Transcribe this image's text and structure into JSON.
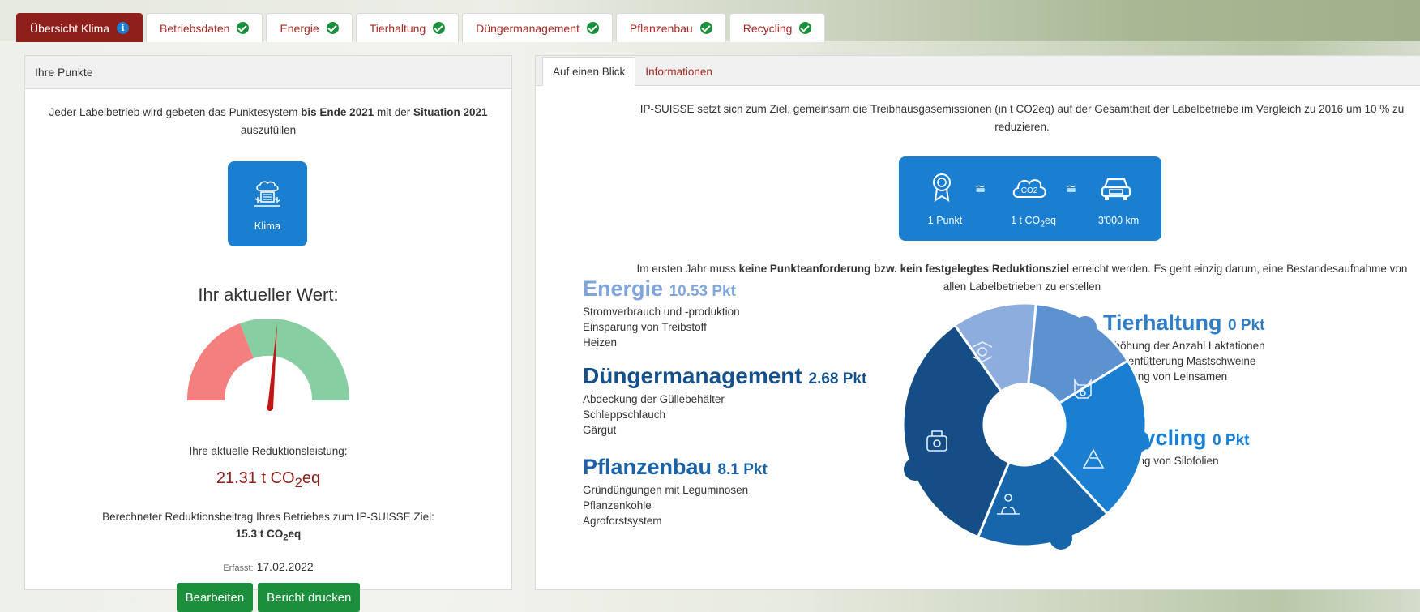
{
  "tabs": [
    {
      "label": "Übersicht Klima",
      "status": "info"
    },
    {
      "label": "Betriebsdaten",
      "status": "done"
    },
    {
      "label": "Energie",
      "status": "done"
    },
    {
      "label": "Tierhaltung",
      "status": "done"
    },
    {
      "label": "Düngermanagement",
      "status": "done"
    },
    {
      "label": "Pflanzenbau",
      "status": "done"
    },
    {
      "label": "Recycling",
      "status": "done"
    }
  ],
  "left": {
    "header": "Ihre Punkte",
    "intro_1": "Jeder Labelbetrieb wird gebeten das Punktesystem ",
    "intro_bold_1": "bis Ende 2021",
    "intro_2": " mit der ",
    "intro_bold_2": "Situation 2021",
    "intro_3": " auszufüllen",
    "klima_label": "Klima",
    "current_title": "Ihr aktueller Wert:",
    "gauge_level": 0.55,
    "reduction_label": "Ihre aktuelle Reduktionsleistung:",
    "reduction_value": "21.31",
    "reduction_unit_prefix": " t CO",
    "reduction_unit_sub": "2",
    "reduction_unit_suffix": "eq",
    "calc_label": "Berechneter Reduktionsbeitrag Ihres Betriebes zum IP-SUISSE Ziel:",
    "calc_value": "15.3 t CO",
    "calc_sub": "2",
    "calc_suffix": "eq",
    "erfasst_label": "Erfasst:",
    "erfasst_date": "17.02.2022",
    "edit_button": "Bearbeiten",
    "print_button": "Bericht drucken"
  },
  "right": {
    "tabs": [
      "Auf einen Blick",
      "Informationen"
    ],
    "goal_text": "IP-SUISSE setzt sich zum Ziel, gemeinsam die Treibhausgasemissionen (in t CO2eq) auf der Gesamtheit der Labelbetriebe im Vergleich zu 2016 um 10 % zu reduzieren.",
    "eq_point": "1 Punkt",
    "eq_co2_prefix": "1 t CO",
    "eq_co2_sub": "2",
    "eq_co2_suffix": "eq",
    "eq_km": "3'000 km",
    "approx": "≅",
    "cloud_text": "CO2",
    "firstyear_1": "Im ersten Jahr muss ",
    "firstyear_bold": "keine Punkteanforderung bzw. kein festgelegtes Reduktionsziel",
    "firstyear_2": " erreicht werden. Es geht einzig darum, eine Bestandesaufnahme von allen Labelbetrieben zu erstellen",
    "categories": {
      "energie": {
        "title": "Energie",
        "points": "10.53 Pkt",
        "items": [
          "Stromverbrauch und -produktion",
          "Einsparung von Treibstoff",
          "Heizen"
        ]
      },
      "dunger": {
        "title": "Düngermanagement",
        "points": "2.68 Pkt",
        "items": [
          "Abdeckung der Güllebehälter",
          "Schleppschlauch",
          "Gärgut"
        ]
      },
      "pflanzen": {
        "title": "Pflanzenbau",
        "points": "8.1 Pkt",
        "items": [
          "Gründüngungen mit Leguminosen",
          "Pflanzenkohle",
          "Agroforstsystem"
        ]
      },
      "tier": {
        "title": "Tierhaltung",
        "points": "0 Pkt",
        "items": [
          "Erhöhung der Anzahl Laktationen",
          "Phasenfütterung Mastschweine",
          "Fütterung von Leinsamen"
        ]
      },
      "recyc": {
        "title": "Recycling",
        "points": "0 Pkt",
        "items": [
          "Recycling von Silofolien"
        ]
      }
    }
  },
  "colors": {
    "brand_red": "#8e1f1a",
    "accent_blue": "#1a7fd0",
    "success_green": "#1c8f3c",
    "gauge_red": "#f47f7f",
    "gauge_green": "#87cfa2"
  }
}
